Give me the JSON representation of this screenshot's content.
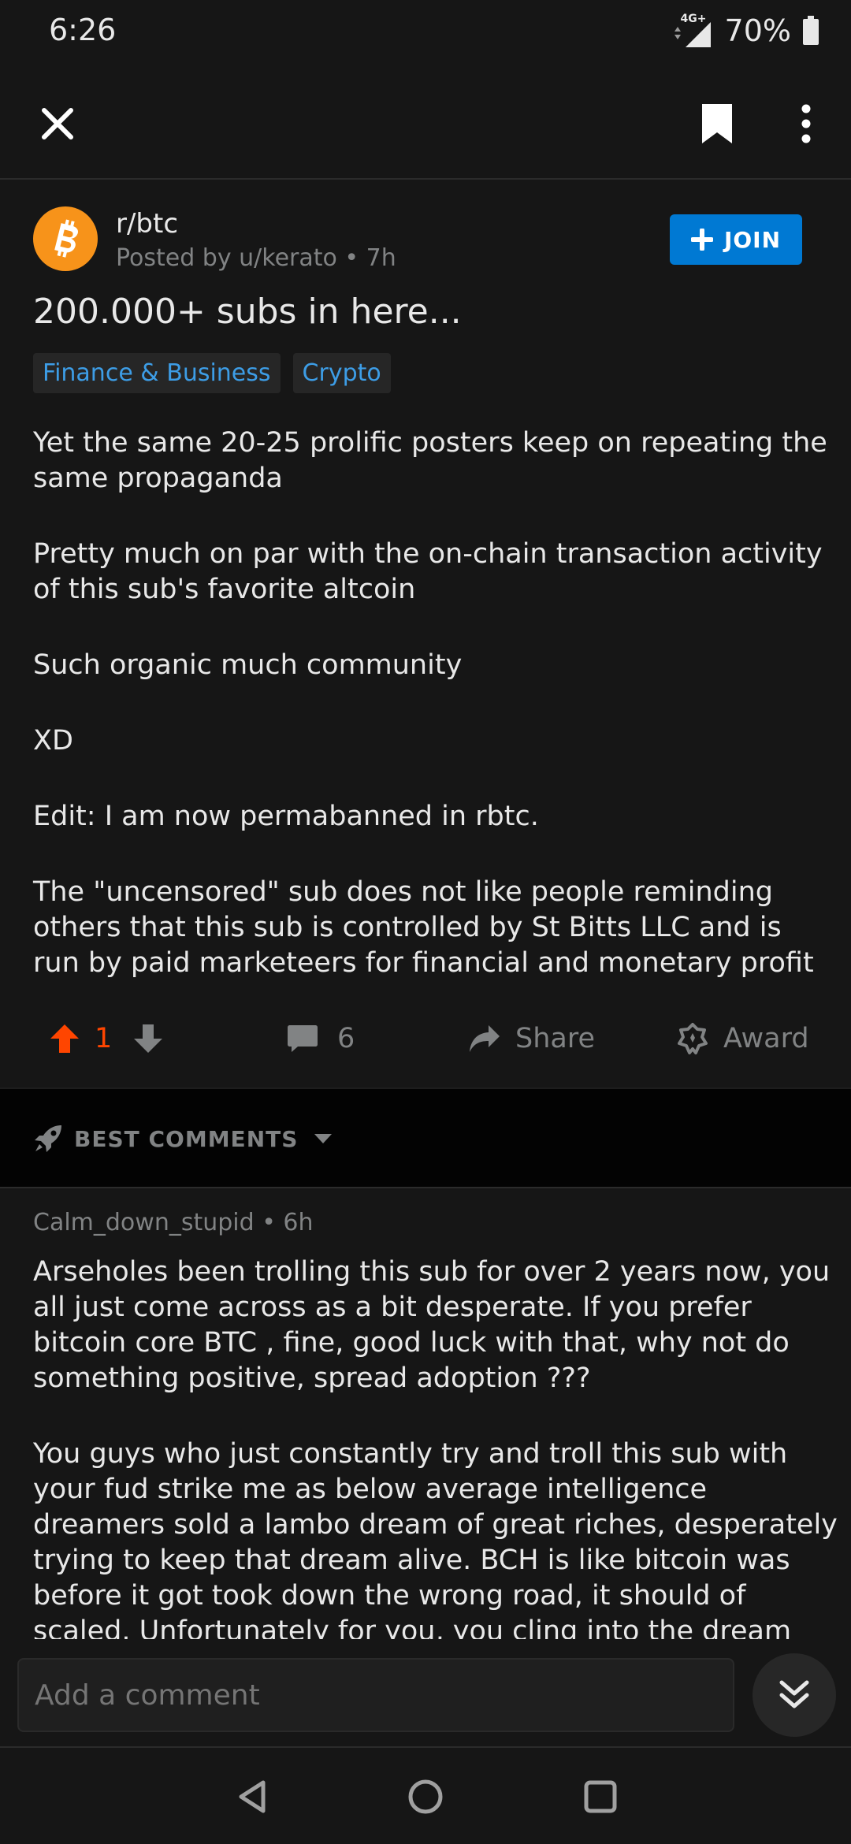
{
  "status": {
    "time": "6:26",
    "network": "4G+",
    "battery": "70%"
  },
  "post": {
    "subreddit": "r/btc",
    "posted_by": "Posted by u/kerato • 7h",
    "join_label": "JOIN",
    "title": "200.000+ subs in here...",
    "flairs": [
      "Finance & Business",
      "Crypto"
    ],
    "body": [
      "Yet the same 20-25 prolific posters keep on repeating the same propaganda",
      "Pretty much on par with the on-chain transaction activity of this sub's favorite altcoin",
      "Such organic much community",
      "XD",
      "Edit: I am now permabanned in rbtc.",
      "The \"uncensored\" sub does not like people reminding others that this sub is controlled by St Bitts LLC and is run by paid marketeers for financial and monetary profit"
    ]
  },
  "actions": {
    "score": "1",
    "comments": "6",
    "share": "Share",
    "award": "Award"
  },
  "sort": {
    "label": "BEST COMMENTS"
  },
  "comment": {
    "author_meta": "Calm_down_stupid • 6h",
    "body": [
      "Arseholes been trolling this sub for over 2 years now, you all just come across as a bit desperate. If you prefer bitcoin core BTC , fine, good luck with that, why not do something positive, spread adoption ???",
      "You guys who just constantly try and troll this sub with your fud strike me as below average intelligence dreamers sold a lambo dream of great riches, desperately trying to keep that dream alive. BCH is like bitcoin was before it got took down the wrong road, it should of scaled. Unfortunately for you, you cling into the dream"
    ]
  },
  "compose": {
    "placeholder": "Add a comment"
  },
  "colors": {
    "background": "#161616",
    "accent": "#0079d3",
    "upvote": "#ff4500",
    "flair_text": "#3d9de6",
    "btc_orange": "#f7931a"
  },
  "icons": [
    "close-icon",
    "bookmark-icon",
    "more-vert-icon",
    "bitcoin-icon",
    "plus-icon",
    "upvote-icon",
    "downvote-icon",
    "comment-icon",
    "share-icon",
    "award-icon",
    "rocket-icon",
    "caret-down-icon",
    "chevrons-down-icon",
    "back-icon",
    "home-icon",
    "recents-icon"
  ]
}
